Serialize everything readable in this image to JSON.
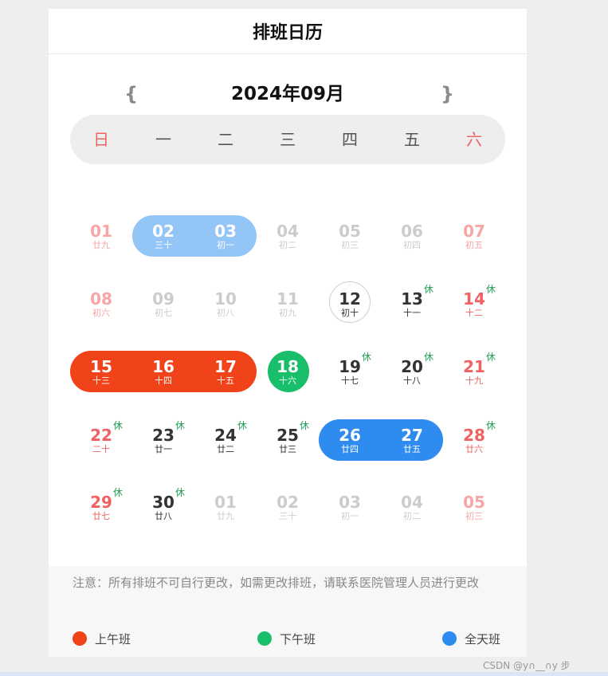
{
  "header": {
    "title": "排班日历"
  },
  "nav": {
    "prev_label": "{",
    "next_label": "}",
    "month": "2024年09月"
  },
  "weekdays": [
    "日",
    "一",
    "二",
    "三",
    "四",
    "五",
    "六"
  ],
  "shift_colors": {
    "morning": "#f0431a",
    "afternoon": "#18be6a",
    "full": "#2e8bef"
  },
  "days": [
    {
      "num": "01",
      "lunar": "廿九",
      "kind": "pastwk"
    },
    {
      "num": "02",
      "lunar": "三十",
      "kind": "white"
    },
    {
      "num": "03",
      "lunar": "初一",
      "kind": "white"
    },
    {
      "num": "04",
      "lunar": "初二",
      "kind": "past"
    },
    {
      "num": "05",
      "lunar": "初三",
      "kind": "past"
    },
    {
      "num": "06",
      "lunar": "初四",
      "kind": "past"
    },
    {
      "num": "07",
      "lunar": "初五",
      "kind": "pastwk"
    },
    {
      "num": "08",
      "lunar": "初六",
      "kind": "pastwk"
    },
    {
      "num": "09",
      "lunar": "初七",
      "kind": "past"
    },
    {
      "num": "10",
      "lunar": "初八",
      "kind": "past"
    },
    {
      "num": "11",
      "lunar": "初九",
      "kind": "past"
    },
    {
      "num": "12",
      "lunar": "初十",
      "kind": "normal",
      "today": true
    },
    {
      "num": "13",
      "lunar": "十一",
      "kind": "normal",
      "rest": "休"
    },
    {
      "num": "14",
      "lunar": "十二",
      "kind": "weekend",
      "rest": "休"
    },
    {
      "num": "15",
      "lunar": "十三",
      "kind": "white"
    },
    {
      "num": "16",
      "lunar": "十四",
      "kind": "white"
    },
    {
      "num": "17",
      "lunar": "十五",
      "kind": "white"
    },
    {
      "num": "18",
      "lunar": "十六",
      "kind": "white"
    },
    {
      "num": "19",
      "lunar": "十七",
      "kind": "normal",
      "rest": "休"
    },
    {
      "num": "20",
      "lunar": "十八",
      "kind": "normal",
      "rest": "休"
    },
    {
      "num": "21",
      "lunar": "十九",
      "kind": "weekend",
      "rest": "休"
    },
    {
      "num": "22",
      "lunar": "二十",
      "kind": "weekend",
      "rest": "休"
    },
    {
      "num": "23",
      "lunar": "廿一",
      "kind": "normal",
      "rest": "休"
    },
    {
      "num": "24",
      "lunar": "廿二",
      "kind": "normal",
      "rest": "休"
    },
    {
      "num": "25",
      "lunar": "廿三",
      "kind": "normal",
      "rest": "休"
    },
    {
      "num": "26",
      "lunar": "廿四",
      "kind": "white"
    },
    {
      "num": "27",
      "lunar": "廿五",
      "kind": "white"
    },
    {
      "num": "28",
      "lunar": "廿六",
      "kind": "weekend",
      "rest": "休"
    },
    {
      "num": "29",
      "lunar": "廿七",
      "kind": "weekend",
      "rest": "休"
    },
    {
      "num": "30",
      "lunar": "廿八",
      "kind": "normal",
      "rest": "休"
    },
    {
      "num": "01",
      "lunar": "廿九",
      "kind": "other"
    },
    {
      "num": "02",
      "lunar": "三十",
      "kind": "other"
    },
    {
      "num": "03",
      "lunar": "初一",
      "kind": "other"
    },
    {
      "num": "04",
      "lunar": "初二",
      "kind": "other"
    },
    {
      "num": "05",
      "lunar": "初三",
      "kind": "otherwk"
    }
  ],
  "note": "注意：所有排班不可自行更改，如需更改排班，请联系医院管理人员进行更改",
  "legend": [
    {
      "label": "上午班",
      "color": "#f0431a"
    },
    {
      "label": "下午班",
      "color": "#18be6a"
    },
    {
      "label": "全天班",
      "color": "#2e8bef"
    }
  ],
  "watermark": "CSDN @y∩__∩y  步"
}
